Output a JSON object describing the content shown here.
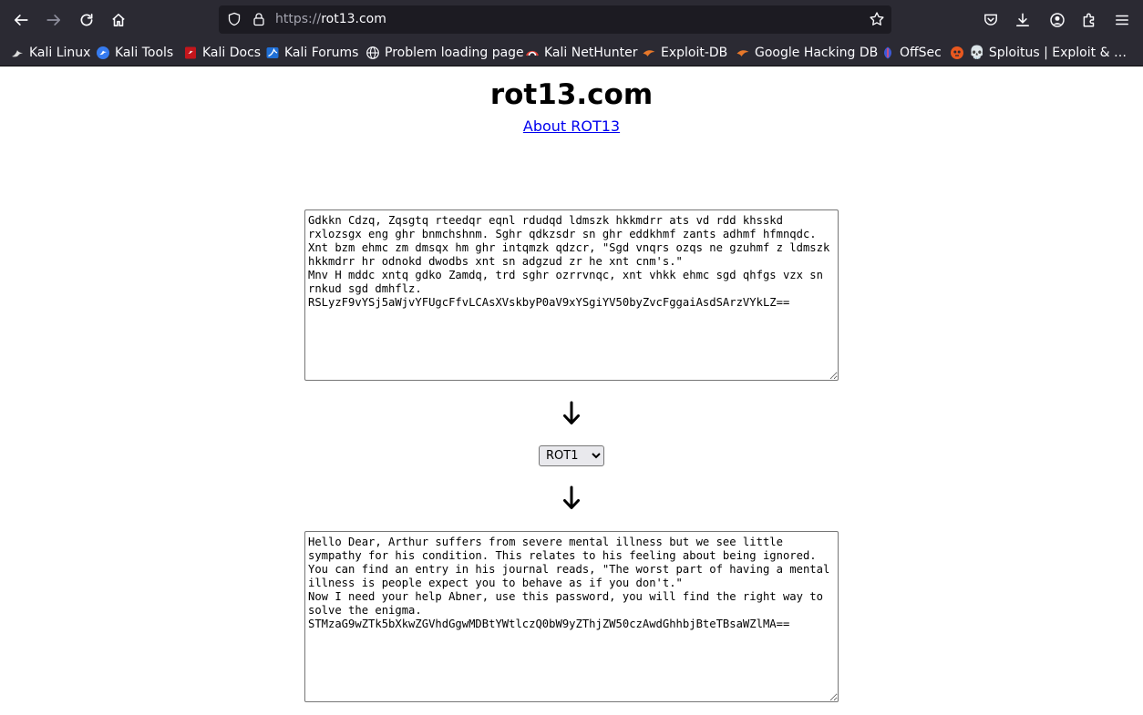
{
  "browser": {
    "url_scheme": "https://",
    "url_host": "rot13.com"
  },
  "bookmarks": [
    {
      "label": "Kali Linux",
      "icon": "kali-dragon-icon"
    },
    {
      "label": "Kali Tools",
      "icon": "kali-tools-icon"
    },
    {
      "label": "Kali Docs",
      "icon": "kali-docs-icon"
    },
    {
      "label": "Kali Forums",
      "icon": "kali-forums-icon"
    },
    {
      "label": "Problem loading page",
      "icon": "globe-icon"
    },
    {
      "label": "Kali NetHunter",
      "icon": "nethunter-icon"
    },
    {
      "label": "Exploit-DB",
      "icon": "exploitdb-icon"
    },
    {
      "label": "Google Hacking DB",
      "icon": "ghdb-icon"
    },
    {
      "label": "OffSec",
      "icon": "offsec-icon"
    },
    {
      "label": "💀 Sploitus | Exploit & …",
      "icon": "sploitus-icon"
    }
  ],
  "page": {
    "title": "rot13.com",
    "about_link": "About ROT13",
    "input_text": "Gdkkn Cdzq, Zqsgtq rteedqr eqnl rdudqd ldmszk hkkmdrr ats vd rdd khsskd rxlozsgx eng ghr bnmchshnm. Sghr qdkzsdr sn ghr eddkhmf zants adhmf hfmnqdc. Xnt bzm ehmc zm dmsqx hm ghr intqmzk qdzcr, \"Sgd vnqrs ozqs ne gzuhmf z ldmszk hkkmdrr hr odnokd dwodbs xnt sn adgzud zr he xnt cnm's.\"\nMnv H mddc xntq gdko Zamdq, trd sghr ozrrvnqc, xnt vhkk ehmc sgd qhfgs vzx sn rnkud sgd dmhflz.\nRSLyzF9vYSj5aWjvYFUgcFfvLCAsXVskbyP0aV9xYSgiYV50byZvcFggaiAsdSArzVYkLZ==",
    "rotation_selected": "ROT1",
    "rotation_options": [
      "ROT1"
    ],
    "output_text": "Hello Dear, Arthur suffers from severe mental illness but we see little sympathy for his condition. This relates to his feeling about being ignored. You can find an entry in his journal reads, \"The worst part of having a mental illness is people expect you to behave as if you don't.\"\nNow I need your help Abner, use this password, you will find the right way to solve the enigma.\nSTMzaG9wZTk5bXkwZGVhdGgwMDBtYWtlczQ0bW9yZThjZW50czAwdGhhbjBteTBsaWZlMA=="
  }
}
